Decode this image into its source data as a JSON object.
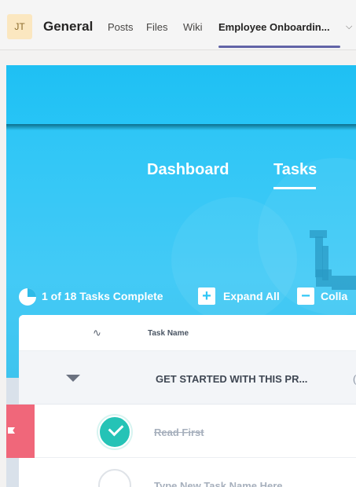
{
  "teams": {
    "avatar_initials": "JT",
    "team_name": "General",
    "tabs": [
      {
        "label": "Posts"
      },
      {
        "label": "Files"
      },
      {
        "label": "Wiki"
      },
      {
        "label": "Employee Onboardin..."
      }
    ],
    "active_tab_index": 3,
    "accent_color": "#6264a7"
  },
  "app": {
    "nav": [
      {
        "label": "Dashboard"
      },
      {
        "label": "Tasks"
      }
    ],
    "active_nav": "Tasks",
    "progress": {
      "completed": 1,
      "total": 18
    },
    "toolbar": {
      "progress_text": "1 of 18 Tasks Complete",
      "expand_label": "Expand All",
      "collapse_label": "Colla"
    },
    "table": {
      "column_header": "Task Name",
      "group": {
        "title": "GET STARTED WITH THIS PR...",
        "extra": "("
      },
      "tasks": [
        {
          "name": "Read First",
          "done": true
        },
        {
          "name": "Type New Task Name Here",
          "done": false
        }
      ]
    },
    "colors": {
      "hero": "#2ec6f6",
      "done": "#25c3b6",
      "flag": "#f0677a"
    }
  }
}
